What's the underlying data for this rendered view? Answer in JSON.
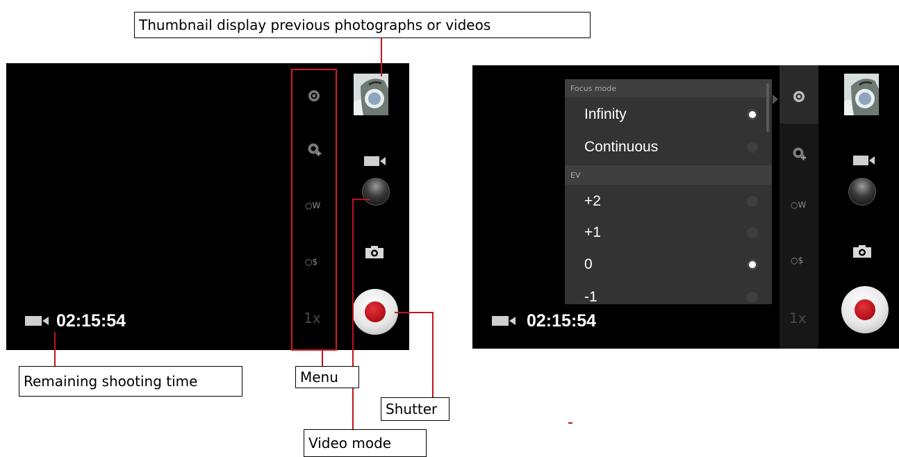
{
  "callouts": {
    "thumbnail": "Thumbnail display previous photographs or videos",
    "remaining_time": "Remaining shooting time",
    "menu": "Menu",
    "shutter": "Shutter",
    "video_mode": "Video mode"
  },
  "left_screen": {
    "timer": "02:15:54",
    "menu_icons": [
      "focus-mode-icon",
      "exposure-icon",
      "white-balance-icon",
      "scene-mode-icon"
    ],
    "zoom_label": "1x"
  },
  "right_screen": {
    "timer": "02:15:54",
    "zoom_label": "1x",
    "popup": {
      "focus_header": "Focus mode",
      "focus_options": [
        {
          "label": "Infinity",
          "selected": true
        },
        {
          "label": "Continuous",
          "selected": false
        }
      ],
      "ev_header": "EV",
      "ev_options": [
        {
          "label": "+2",
          "selected": false
        },
        {
          "label": "+1",
          "selected": false
        },
        {
          "label": "0",
          "selected": true
        },
        {
          "label": "-1",
          "selected": false
        }
      ]
    }
  },
  "colors": {
    "annotation_line": "#c0141a",
    "shutter_red": "#b30f17"
  }
}
